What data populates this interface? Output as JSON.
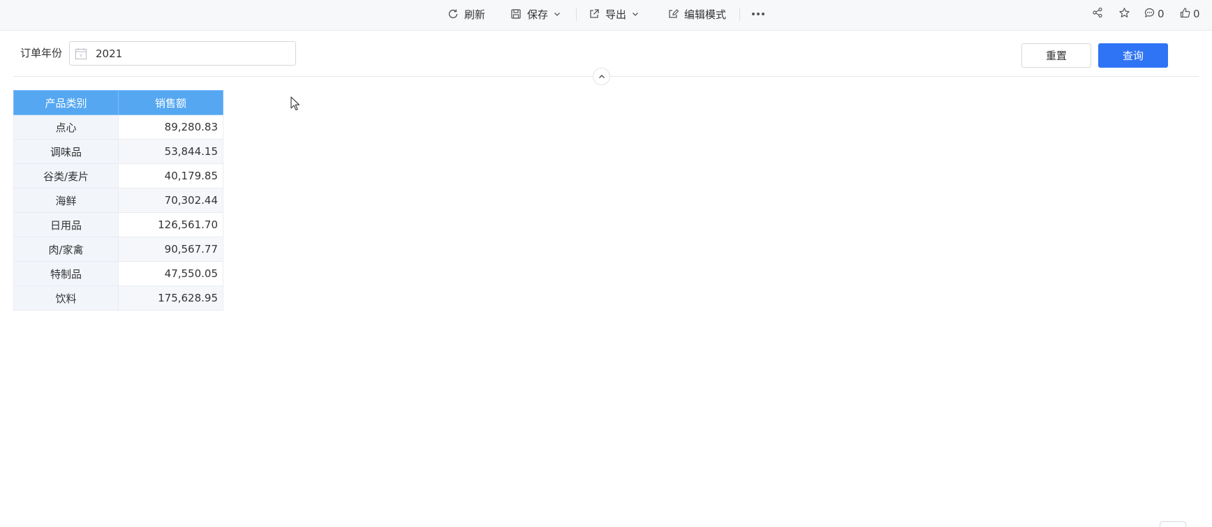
{
  "toolbar": {
    "refresh": "刷新",
    "save": "保存",
    "export": "导出",
    "edit_mode": "编辑模式",
    "comments_count": "0",
    "likes_count": "0"
  },
  "filter": {
    "label": "订单年份",
    "year_value": "2021"
  },
  "buttons": {
    "reset": "重置",
    "query": "查询"
  },
  "table": {
    "headers": [
      "产品类别",
      "销售额"
    ],
    "rows": [
      [
        "点心",
        "89,280.83"
      ],
      [
        "调味品",
        "53,844.15"
      ],
      [
        "谷类/麦片",
        "40,179.85"
      ],
      [
        "海鲜",
        "70,302.44"
      ],
      [
        "日用品",
        "126,561.70"
      ],
      [
        "肉/家禽",
        "90,567.77"
      ],
      [
        "特制品",
        "47,550.05"
      ],
      [
        "饮料",
        "175,628.95"
      ]
    ]
  },
  "colors": {
    "accent": "#2f74f5",
    "table_header": "#55a7f2"
  }
}
